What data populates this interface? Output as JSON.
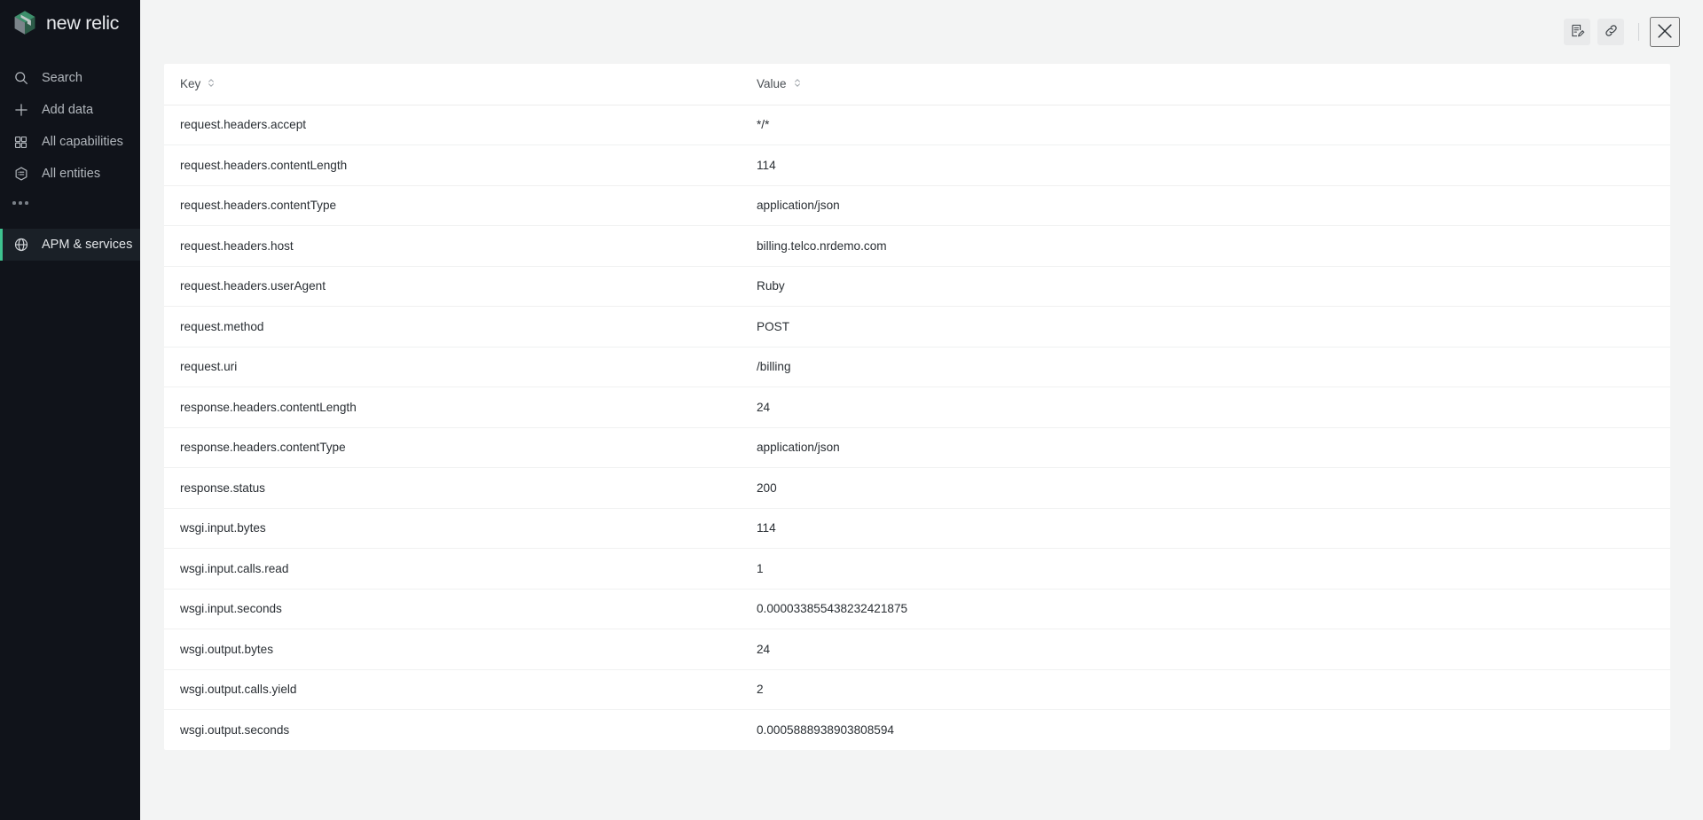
{
  "sidebar": {
    "brand": "new relic",
    "items": [
      {
        "label": "Search",
        "icon": "search-icon",
        "active": false
      },
      {
        "label": "Add data",
        "icon": "plus-icon",
        "active": false
      },
      {
        "label": "All capabilities",
        "icon": "grid-icon",
        "active": false
      },
      {
        "label": "All entities",
        "icon": "hexagon-list-icon",
        "active": false
      }
    ],
    "more_label": "...",
    "active_item": {
      "label": "APM & services",
      "icon": "globe-icon",
      "active": true
    }
  },
  "toolbar": {
    "annotate_label": "Add note",
    "copy_link_label": "Copy permalink",
    "close_label": "Close"
  },
  "table": {
    "columns": [
      {
        "key": "key",
        "label": "Key"
      },
      {
        "key": "value",
        "label": "Value"
      }
    ],
    "rows": [
      {
        "key": "request.headers.accept",
        "value": "*/*"
      },
      {
        "key": "request.headers.contentLength",
        "value": "114"
      },
      {
        "key": "request.headers.contentType",
        "value": "application/json"
      },
      {
        "key": "request.headers.host",
        "value": "billing.telco.nrdemo.com"
      },
      {
        "key": "request.headers.userAgent",
        "value": "Ruby"
      },
      {
        "key": "request.method",
        "value": "POST"
      },
      {
        "key": "request.uri",
        "value": "/billing"
      },
      {
        "key": "response.headers.contentLength",
        "value": "24"
      },
      {
        "key": "response.headers.contentType",
        "value": "application/json"
      },
      {
        "key": "response.status",
        "value": "200"
      },
      {
        "key": "wsgi.input.bytes",
        "value": "114"
      },
      {
        "key": "wsgi.input.calls.read",
        "value": "1"
      },
      {
        "key": "wsgi.input.seconds",
        "value": "0.000033855438232421875"
      },
      {
        "key": "wsgi.output.bytes",
        "value": "24"
      },
      {
        "key": "wsgi.output.calls.yield",
        "value": "2"
      },
      {
        "key": "wsgi.output.seconds",
        "value": "0.0005888938903808594"
      }
    ]
  },
  "colors": {
    "sidebar_bg": "#10131a",
    "accent_green": "#3ec28f",
    "page_bg": "#f3f4f4",
    "table_bg": "#ffffff",
    "text_primary": "#2a2f34"
  }
}
